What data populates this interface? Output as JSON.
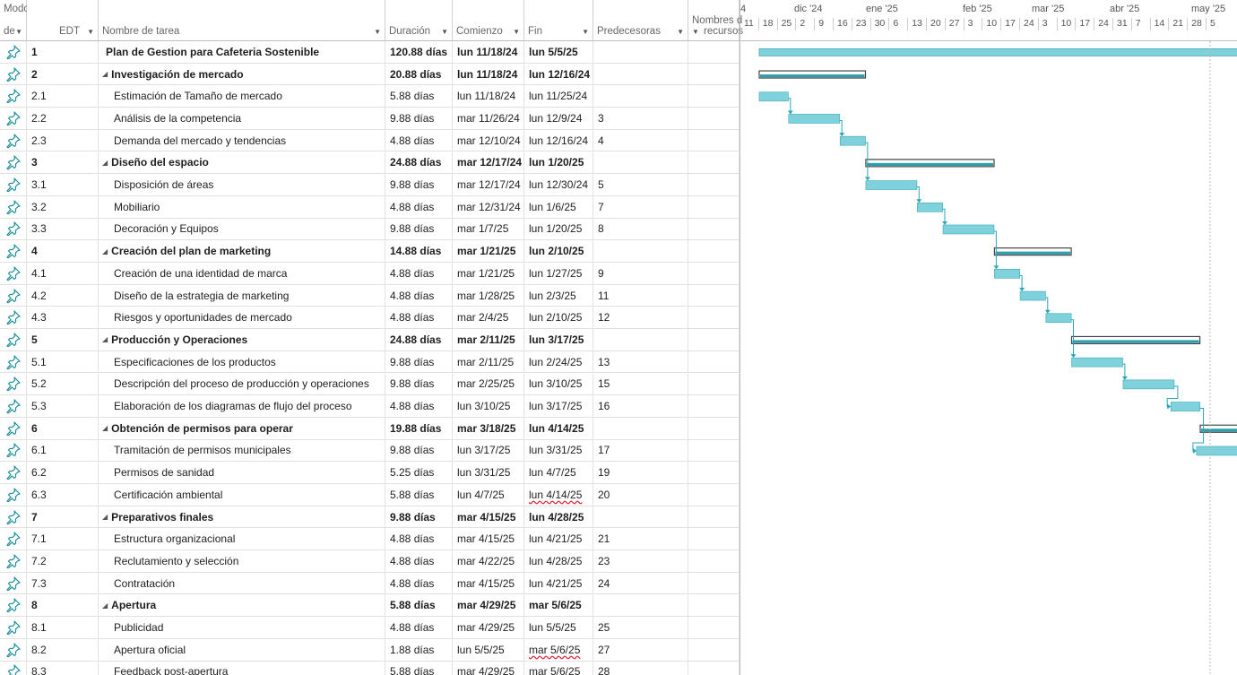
{
  "columns": {
    "mode_l1": "Modo",
    "mode_l2": "de",
    "edt": "EDT",
    "name": "Nombre de tarea",
    "duration": "Duración",
    "start": "Comienzo",
    "finish": "Fin",
    "pred": "Predecesoras",
    "res_l1": "Nombres d",
    "res_l2": "recursos"
  },
  "timescale": {
    "months": [
      "4",
      "dic '24",
      "ene '25",
      "feb '25",
      "mar '25",
      "abr '25",
      "may '25"
    ],
    "weeks": [
      "11",
      "18",
      "25",
      "2",
      "9",
      "16",
      "23",
      "30",
      "6",
      "13",
      "20",
      "27",
      "3",
      "10",
      "17",
      "24",
      "3",
      "10",
      "17",
      "24",
      "31",
      "7",
      "14",
      "21",
      "28",
      "5"
    ]
  },
  "colors": {
    "bar": "#7fd1db",
    "bar_edge": "#3aa9b7",
    "summary": "#2a9fad",
    "arrow": "#2aa7b5"
  },
  "tasks": [
    {
      "edt": "1",
      "name": "Plan de Gestion para Cafeteria Sostenible",
      "duration": "120.88 días",
      "start": "lun 11/18/24",
      "finish": "lun 5/5/25",
      "pred": "",
      "level": 0,
      "summary": true,
      "collapse": false
    },
    {
      "edt": "2",
      "name": "Investigación de mercado",
      "duration": "20.88 días",
      "start": "lun 11/18/24",
      "finish": "lun 12/16/24",
      "pred": "",
      "level": 1,
      "summary": true,
      "collapse": true
    },
    {
      "edt": "2.1",
      "name": "Estimación de Tamaño de mercado",
      "duration": "5.88 días",
      "start": "lun 11/18/24",
      "finish": "lun 11/25/24",
      "pred": "",
      "level": 2
    },
    {
      "edt": "2.2",
      "name": "Análisis de la competencia",
      "duration": "9.88 días",
      "start": "mar 11/26/24",
      "finish": "lun 12/9/24",
      "pred": "3",
      "level": 2
    },
    {
      "edt": "2.3",
      "name": "Demanda del mercado y tendencias",
      "duration": "4.88 días",
      "start": "mar 12/10/24",
      "finish": "lun 12/16/24",
      "pred": "4",
      "level": 2
    },
    {
      "edt": "3",
      "name": "Diseño del espacio",
      "duration": "24.88 días",
      "start": "mar 12/17/24",
      "finish": "lun 1/20/25",
      "pred": "",
      "level": 1,
      "summary": true,
      "collapse": true
    },
    {
      "edt": "3.1",
      "name": "Disposición de áreas",
      "duration": "9.88 días",
      "start": "mar 12/17/24",
      "finish": "lun 12/30/24",
      "pred": "5",
      "level": 2
    },
    {
      "edt": "3.2",
      "name": "Mobiliario",
      "duration": "4.88 días",
      "start": "mar 12/31/24",
      "finish": "lun 1/6/25",
      "pred": "7",
      "level": 2
    },
    {
      "edt": "3.3",
      "name": "Decoración y Equipos",
      "duration": "9.88 días",
      "start": "mar 1/7/25",
      "finish": "lun 1/20/25",
      "pred": "8",
      "level": 2
    },
    {
      "edt": "4",
      "name": "Creación del plan de marketing",
      "duration": "14.88 días",
      "start": "mar 1/21/25",
      "finish": "lun 2/10/25",
      "pred": "",
      "level": 1,
      "summary": true,
      "collapse": true
    },
    {
      "edt": "4.1",
      "name": "Creación de una identidad de marca",
      "duration": "4.88 días",
      "start": "mar 1/21/25",
      "finish": "lun 1/27/25",
      "pred": "9",
      "level": 2
    },
    {
      "edt": "4.2",
      "name": "Diseño de la estrategia de marketing",
      "duration": "4.88 días",
      "start": "mar 1/28/25",
      "finish": "lun 2/3/25",
      "pred": "11",
      "level": 2
    },
    {
      "edt": "4.3",
      "name": "Riesgos y oportunidades de mercado",
      "duration": "4.88 días",
      "start": "mar 2/4/25",
      "finish": "lun 2/10/25",
      "pred": "12",
      "level": 2
    },
    {
      "edt": "5",
      "name": "Producción y Operaciones",
      "duration": "24.88 días",
      "start": "mar 2/11/25",
      "finish": "lun 3/17/25",
      "pred": "",
      "level": 1,
      "summary": true,
      "collapse": true
    },
    {
      "edt": "5.1",
      "name": "Especificaciones de los productos",
      "duration": "9.88 días",
      "start": "mar 2/11/25",
      "finish": "lun 2/24/25",
      "pred": "13",
      "level": 2
    },
    {
      "edt": "5.2",
      "name": "Descripción del proceso de producción y operaciones",
      "duration": "9.88 días",
      "start": "mar 2/25/25",
      "finish": "lun 3/10/25",
      "pred": "15",
      "level": 2
    },
    {
      "edt": "5.3",
      "name": "Elaboración de los diagramas de flujo del proceso",
      "duration": "4.88 días",
      "start": "lun 3/10/25",
      "finish": "lun 3/17/25",
      "pred": "16",
      "level": 2
    },
    {
      "edt": "6",
      "name": "Obtención de permisos para operar",
      "duration": "19.88 días",
      "start": "mar 3/18/25",
      "finish": "lun 4/14/25",
      "pred": "",
      "level": 1,
      "summary": true,
      "collapse": true
    },
    {
      "edt": "6.1",
      "name": "Tramitación de permisos municipales",
      "duration": "9.88 días",
      "start": "lun 3/17/25",
      "finish": "lun 3/31/25",
      "pred": "17",
      "level": 2
    },
    {
      "edt": "6.2",
      "name": "Permisos de sanidad",
      "duration": "5.25 días",
      "start": "lun 3/31/25",
      "finish": "lun 4/7/25",
      "pred": "19",
      "level": 2
    },
    {
      "edt": "6.3",
      "name": "Certificación ambiental",
      "duration": "5.88 días",
      "start": "lun 4/7/25",
      "finish": "lun 4/14/25",
      "pred": "20",
      "level": 2,
      "squiggle": true,
      "hatched": true
    },
    {
      "edt": "7",
      "name": "Preparativos finales",
      "duration": "9.88 días",
      "start": "mar 4/15/25",
      "finish": "lun 4/28/25",
      "pred": "",
      "level": 1,
      "summary": true,
      "collapse": true
    },
    {
      "edt": "7.1",
      "name": "Estructura organizacional",
      "duration": "4.88 días",
      "start": "mar 4/15/25",
      "finish": "lun 4/21/25",
      "pred": "21",
      "level": 2
    },
    {
      "edt": "7.2",
      "name": "Reclutamiento y selección",
      "duration": "4.88 días",
      "start": "mar 4/22/25",
      "finish": "lun 4/28/25",
      "pred": "23",
      "level": 2
    },
    {
      "edt": "7.3",
      "name": "Contratación",
      "duration": "4.88 días",
      "start": "mar 4/15/25",
      "finish": "lun 4/21/25",
      "pred": "24",
      "level": 2,
      "hatched": true
    },
    {
      "edt": "8",
      "name": "Apertura",
      "duration": "5.88 días",
      "start": "mar 4/29/25",
      "finish": "mar 5/6/25",
      "pred": "",
      "level": 1,
      "summary": true,
      "collapse": true
    },
    {
      "edt": "8.1",
      "name": "Publicidad",
      "duration": "4.88 días",
      "start": "mar 4/29/25",
      "finish": "lun 5/5/25",
      "pred": "25",
      "level": 2
    },
    {
      "edt": "8.2",
      "name": "Apertura oficial",
      "duration": "1.88 días",
      "start": "lun 5/5/25",
      "finish": "mar 5/6/25",
      "pred": "27",
      "level": 2,
      "squiggle": true
    },
    {
      "edt": "8.3",
      "name": "Feedback post-apertura",
      "duration": "5.88 días",
      "start": "mar 4/29/25",
      "finish": "mar 5/6/25",
      "pred": "28",
      "level": 2,
      "squiggle": true,
      "hatched": true
    }
  ]
}
